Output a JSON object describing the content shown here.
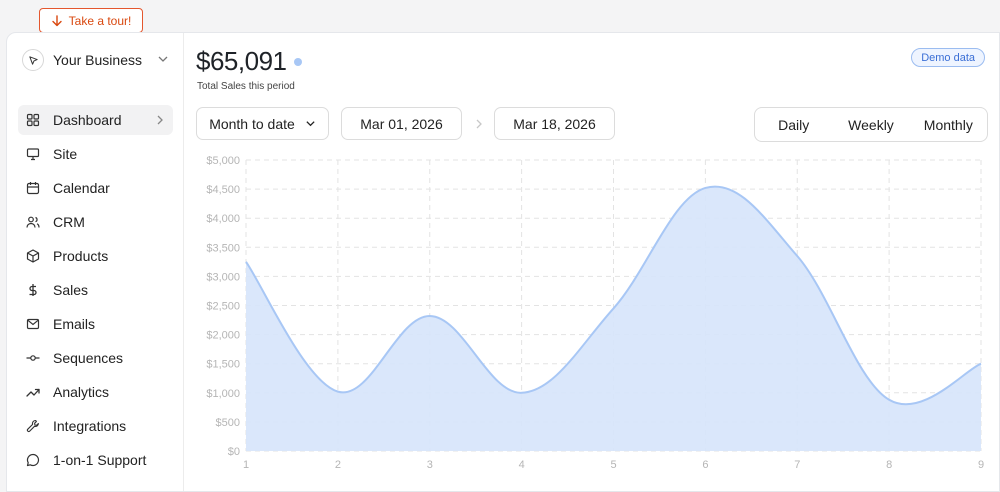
{
  "tour": {
    "label": "Take a tour!"
  },
  "sidebar": {
    "business_name": "Your Business",
    "items": [
      {
        "label": "Dashboard",
        "icon": "grid-icon",
        "active": true
      },
      {
        "label": "Site",
        "icon": "monitor-icon"
      },
      {
        "label": "Calendar",
        "icon": "calendar-icon"
      },
      {
        "label": "CRM",
        "icon": "users-icon"
      },
      {
        "label": "Products",
        "icon": "box-icon"
      },
      {
        "label": "Sales",
        "icon": "dollar-icon"
      },
      {
        "label": "Emails",
        "icon": "mail-icon"
      },
      {
        "label": "Sequences",
        "icon": "sequence-icon"
      },
      {
        "label": "Analytics",
        "icon": "trend-icon"
      },
      {
        "label": "Integrations",
        "icon": "wrench-icon"
      },
      {
        "label": "1-on-1 Support",
        "icon": "chat-icon"
      }
    ]
  },
  "header": {
    "total": "$65,091",
    "total_label": "Total Sales this period",
    "demo_badge": "Demo data"
  },
  "filters": {
    "range": "Month to date",
    "start_date": "Mar 01, 2026",
    "end_date": "Mar 18, 2026",
    "periods": [
      "Daily",
      "Weekly",
      "Monthly"
    ]
  },
  "colors": {
    "accent": "#a8c7f5",
    "fill": "#d6e4fb",
    "tour": "#d9480f"
  },
  "chart_data": {
    "type": "area",
    "x": [
      1,
      2,
      3,
      4,
      5,
      6,
      7,
      8,
      9
    ],
    "values": [
      3250,
      1020,
      2320,
      1000,
      2450,
      4520,
      3350,
      880,
      1500
    ],
    "ylim": [
      0,
      5000
    ],
    "y_ticks": [
      "$0",
      "$500",
      "$1,000",
      "$1,500",
      "$2,000",
      "$2,500",
      "$3,000",
      "$3,500",
      "$4,000",
      "$4,500",
      "$5,000"
    ],
    "grid": true
  }
}
